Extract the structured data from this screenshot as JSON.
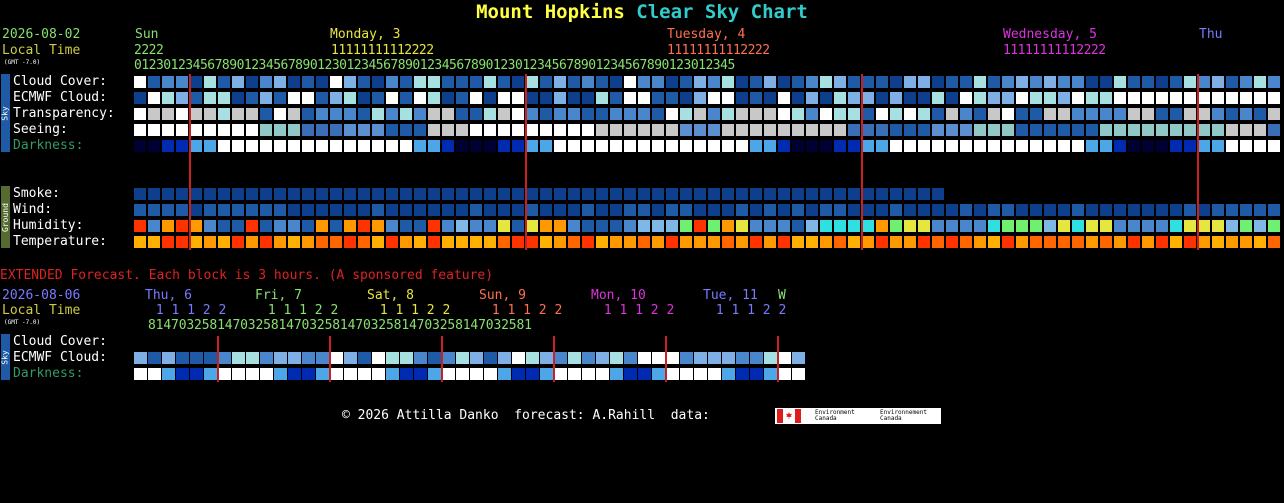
{
  "title": {
    "part1": "Mount Hopkins",
    "part2": "Clear Sky Chart",
    "color1": "#ffff44",
    "color2": "#33cccc"
  },
  "main": {
    "date": "2026-08-02",
    "local_time": "Local Time",
    "gmt": "(GMT -7.0)",
    "days": [
      {
        "label": "Sun",
        "color": "#88e070"
      },
      {
        "label": "Monday, 3",
        "color": "#e6e640"
      },
      {
        "label": "Tuesday, 4",
        "color": "#ff7050"
      },
      {
        "label": "Wednesday, 5",
        "color": "#dd33dd"
      },
      {
        "label": "Thu",
        "color": "#7a7aff"
      }
    ],
    "hours_tens": {
      "sun": "2222",
      "mon": "11111111112222",
      "tue": "11111111112222",
      "wed": "11111111112222"
    },
    "hours_ones": "0123012345678901234567890123012345678901234567890123012345678901234567890123012345",
    "sky_rows": [
      "Cloud Cover:",
      "ECMWF Cloud:",
      "Transparency:",
      "Seeing:",
      "Darkness:"
    ],
    "ground_rows": [
      "Smoke:",
      "Wind:",
      "Humidity:",
      "Temperature:"
    ],
    "sky_tag": "Sky",
    "ground_tag": "Ground"
  },
  "extended": {
    "banner": "EXTENDED Forecast. Each block is 3 hours. (A sponsored feature)",
    "date": "2026-08-06",
    "local_time": "Local Time",
    "gmt": "(GMT -7.0)",
    "days": [
      {
        "label": "Thu, 6",
        "color": "#7a7aff"
      },
      {
        "label": "Fri, 7",
        "color": "#88e070"
      },
      {
        "label": "Sat, 8",
        "color": "#e6e640"
      },
      {
        "label": "Sun, 9",
        "color": "#ff7050"
      },
      {
        "label": "Mon, 10",
        "color": "#dd33dd"
      },
      {
        "label": "Tue, 11",
        "color": "#7a7aff"
      },
      {
        "label": "W",
        "color": "#88e070"
      }
    ],
    "hours_tens": " 1 1 1 2 2",
    "hours_ones": "81470325",
    "rows": [
      "Cloud Cover:",
      "ECMWF Cloud:",
      "Darkness:"
    ],
    "sky_tag": "Sky"
  },
  "footer": {
    "copyright": "© 2026 Attilla Danko  forecast: A.Rahill  data:",
    "logo_text_1": "Environment",
    "logo_text_2": "Canada",
    "logo_text_3": "Environnement",
    "logo_text_4": "Canada"
  },
  "palette": {
    "cloud": [
      "#0e3f8c",
      "#1f5aa6",
      "#4a86cc",
      "#7eb0e6",
      "#a6e0e0",
      "#c8c8c8",
      "#ffffff"
    ],
    "seeing": [
      "#1f5aa6",
      "#3a6fb8",
      "#5c8fd0",
      "#90c7c7",
      "#c8c8c8",
      "#ffffff"
    ],
    "humidity": [
      "#1f5aa6",
      "#4a86cc",
      "#7fb7e6",
      "#30e0e0",
      "#70f070",
      "#e6e640",
      "#ff9900",
      "#ff3300"
    ],
    "temperature": [
      "#ff3300",
      "#ff6600",
      "#ff9900",
      "#ffb000"
    ],
    "darkness": [
      "#000033",
      "#002bb0",
      "#1f5aa6",
      "#4da6e6",
      "#88ccff",
      "#ffe0a0",
      "#ffffff"
    ],
    "divider": "#cc1f1f",
    "label_color": "#ffffff",
    "dark_label_color": "#339966",
    "date_color": "#88e070",
    "local_color": "#cccc44",
    "ones_color": "#88e070",
    "tens_sun_color": "#88e070",
    "tens_mon_color": "#e6e640",
    "tens_tue_color": "#ff7050",
    "tens_wed_color": "#dd33dd",
    "banner_color": "#dd2222"
  }
}
